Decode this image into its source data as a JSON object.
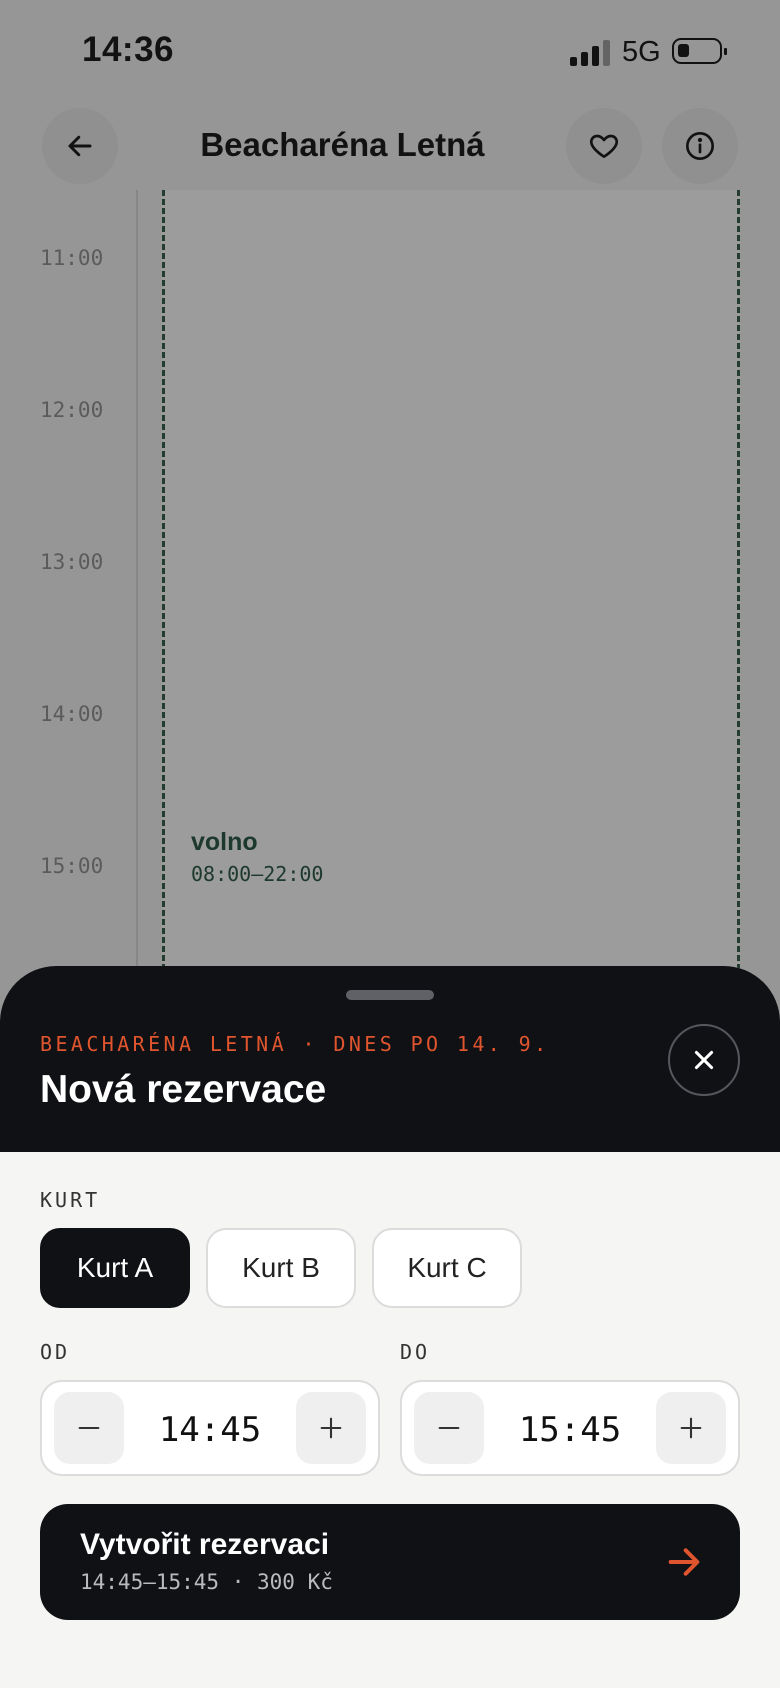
{
  "status_bar": {
    "time": "14:36",
    "network": "5G"
  },
  "header": {
    "title": "Beacharéna Letná",
    "back_icon": "arrow-left-icon",
    "favorite_icon": "heart-icon",
    "info_icon": "info-icon"
  },
  "schedule": {
    "hours": [
      "11:00",
      "12:00",
      "13:00",
      "14:00",
      "15:00"
    ],
    "slot": {
      "status": "volno",
      "range": "08:00–22:00"
    }
  },
  "sheet": {
    "subtitle": "BEACHARÉNA LETNÁ · DNES PO 14. 9.",
    "title": "Nová rezervace",
    "close_icon": "close-icon",
    "court_label": "KURT",
    "courts": [
      {
        "label": "Kurt A",
        "selected": true
      },
      {
        "label": "Kurt B",
        "selected": false
      },
      {
        "label": "Kurt C",
        "selected": false
      }
    ],
    "from_label": "OD",
    "from_value": "14:45",
    "to_label": "DO",
    "to_value": "15:45",
    "cta": {
      "title": "Vytvořit rezervaci",
      "subtitle": "14:45–15:45 · 300 Kč"
    }
  },
  "colors": {
    "accent": "#e0552e",
    "dark": "#0f1115",
    "slot": "#23513c"
  }
}
